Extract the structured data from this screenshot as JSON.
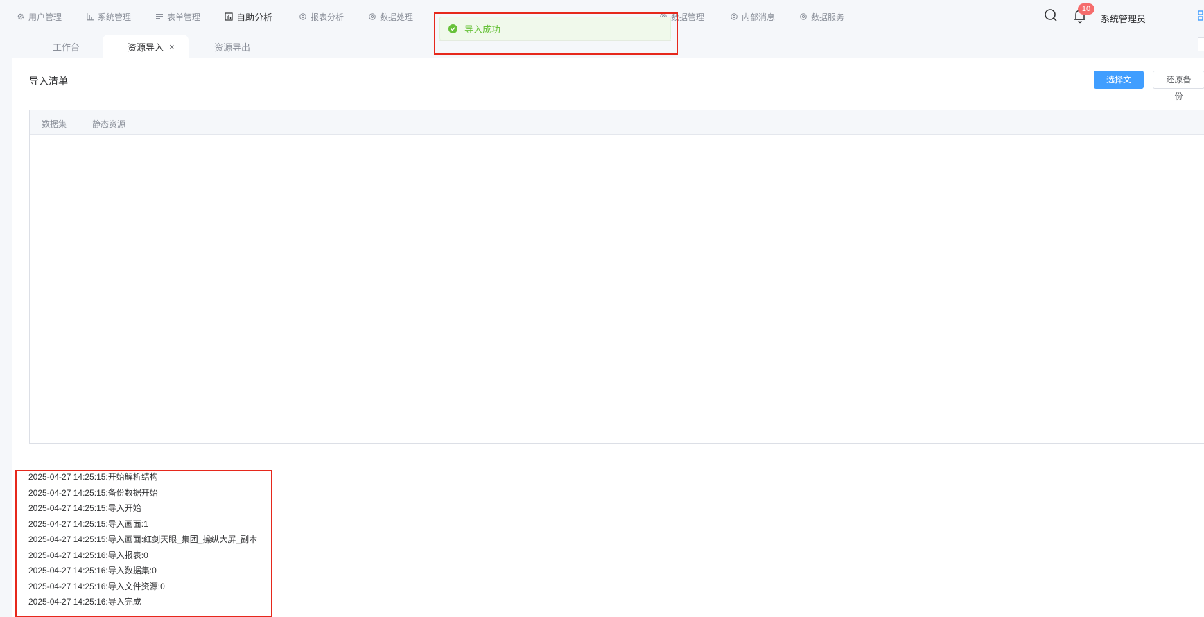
{
  "nav": {
    "items": [
      {
        "label": "用户管理",
        "icon": "gear-icon"
      },
      {
        "label": "系统管理",
        "icon": "bar-chart-icon"
      },
      {
        "label": "表单管理",
        "icon": "form-icon"
      },
      {
        "label": "自助分析",
        "icon": "chart-icon"
      },
      {
        "label": "报表分析",
        "icon": "gear-outline-icon"
      },
      {
        "label": "数据处理",
        "icon": "gear-outline-icon"
      },
      {
        "label": "数据管理",
        "icon": "gear-outline-icon"
      },
      {
        "label": "内部消息",
        "icon": "gear-outline-icon"
      },
      {
        "label": "数据服务",
        "icon": "gear-outline-icon"
      }
    ],
    "active_index": 3,
    "notification_count": "10",
    "user_name": "系统管理员"
  },
  "tabs": [
    {
      "label": "工作台"
    },
    {
      "label": "资源导入",
      "close": "×"
    },
    {
      "label": "资源导出"
    }
  ],
  "toast": {
    "message": "导入成功",
    "type": "success"
  },
  "card": {
    "title": "导入清单",
    "select_file_label": "选择文件",
    "restore_backup_label": "还原备份"
  },
  "table": {
    "columns": [
      "数据集",
      "静态资源"
    ],
    "rows": []
  },
  "log": [
    "2025-04-27 14:25:15:开始解析结构",
    "2025-04-27 14:25:15:备份数据开始",
    "2025-04-27 14:25:15:导入开始",
    "2025-04-27 14:25:15:导入画面:1",
    "2025-04-27 14:25:15:导入画面:红剑天眼_集团_操纵大屏_副本",
    "2025-04-27 14:25:16:导入报表:0",
    "2025-04-27 14:25:16:导入数据集:0",
    "2025-04-27 14:25:16:导入文件资源:0",
    "2025-04-27 14:25:16:导入完成"
  ],
  "colors": {
    "primary": "#409eff",
    "success": "#67c23a",
    "badge": "#f56c6c",
    "annotation": "#e6281c"
  }
}
